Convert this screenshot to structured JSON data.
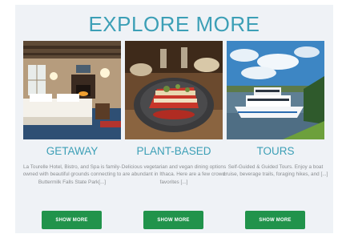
{
  "heading": "EXPLORE MORE",
  "cards": [
    {
      "title": "GETAWAY",
      "description": "La Tourelle Hotel, Bistro, and Spa is family-owned with beautiful grounds connecting to Buttermilk Falls State Park[...]",
      "button_label": "SHOW MORE",
      "image_subject": "hotel room with bed and fireplace"
    },
    {
      "title": "PLANT-BASED",
      "description": "Delicious vegetarian and vegan dining options are abundant in Ithaca. Here are a few crowd favorites [...]",
      "button_label": "SHOW MORE",
      "image_subject": "plate of vegetarian lasagna"
    },
    {
      "title": "TOURS",
      "description": "Self-Guided & Guided Tours. Enjoy a boat cruise, beverage trails, foraging hikes, and [...]",
      "button_label": "SHOW MORE",
      "image_subject": "tour boat on the lake"
    }
  ],
  "colors": {
    "heading": "#3c9fb6",
    "button": "#21934b",
    "panel": "#eff2f6",
    "body_text": "#8a8d90"
  }
}
